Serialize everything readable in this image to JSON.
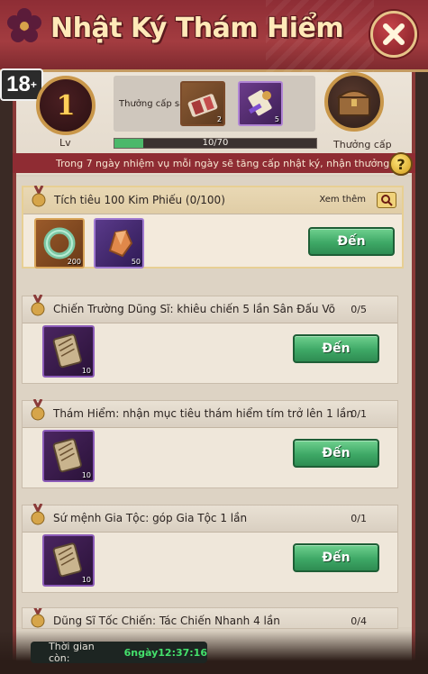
{
  "header": {
    "title": "Nhật Ký Thám Hiểm",
    "age_rating": "18",
    "age_rating_suffix": "+"
  },
  "level": {
    "value": "1",
    "label": "Lv"
  },
  "next_reward": {
    "label": "Thưởng cấp sau",
    "items": [
      {
        "icon": "bundle-icon",
        "count": "2"
      },
      {
        "icon": "scroll-staff-icon",
        "count": "5"
      }
    ]
  },
  "progress": {
    "text": "10/70",
    "current": 10,
    "max": 70
  },
  "level_reward": {
    "label": "Thưởng cấp",
    "icon": "treasure-chest-icon"
  },
  "info_banner": "Trong 7 ngày nhiệm vụ mỗi ngày sẽ tăng cấp nhật ký, nhận thưởng cấp",
  "featured_task": {
    "title": "Tích tiêu 100 Kim Phiếu (0/100)",
    "more_label": "Xem thêm",
    "button": "Đến",
    "rewards": [
      {
        "icon": "jade-ring-icon",
        "count": "200"
      },
      {
        "icon": "crystal-ore-icon",
        "count": "50"
      }
    ]
  },
  "tasks": [
    {
      "title": "Chiến Trường Dũng Sĩ: khiêu chiến 5 lần Sân Đấu Võ",
      "progress": "0/5",
      "button": "Đến",
      "reward_icon": "scroll-icon",
      "reward_count": "10"
    },
    {
      "title": "Thám Hiểm: nhận mục tiêu thám hiểm tím trở lên 1 lần",
      "progress": "0/1",
      "button": "Đến",
      "reward_icon": "scroll-icon",
      "reward_count": "10"
    },
    {
      "title": "Sứ mệnh Gia Tộc: góp Gia Tộc 1 lần",
      "progress": "0/1",
      "button": "Đến",
      "reward_icon": "scroll-icon",
      "reward_count": "10"
    },
    {
      "title": "Dũng Sĩ Tốc Chiến: Tác Chiến Nhanh 4 lần",
      "progress": "0/4"
    }
  ],
  "timer": {
    "label": "Thời gian còn:",
    "value": "6ngày12:37:16"
  }
}
